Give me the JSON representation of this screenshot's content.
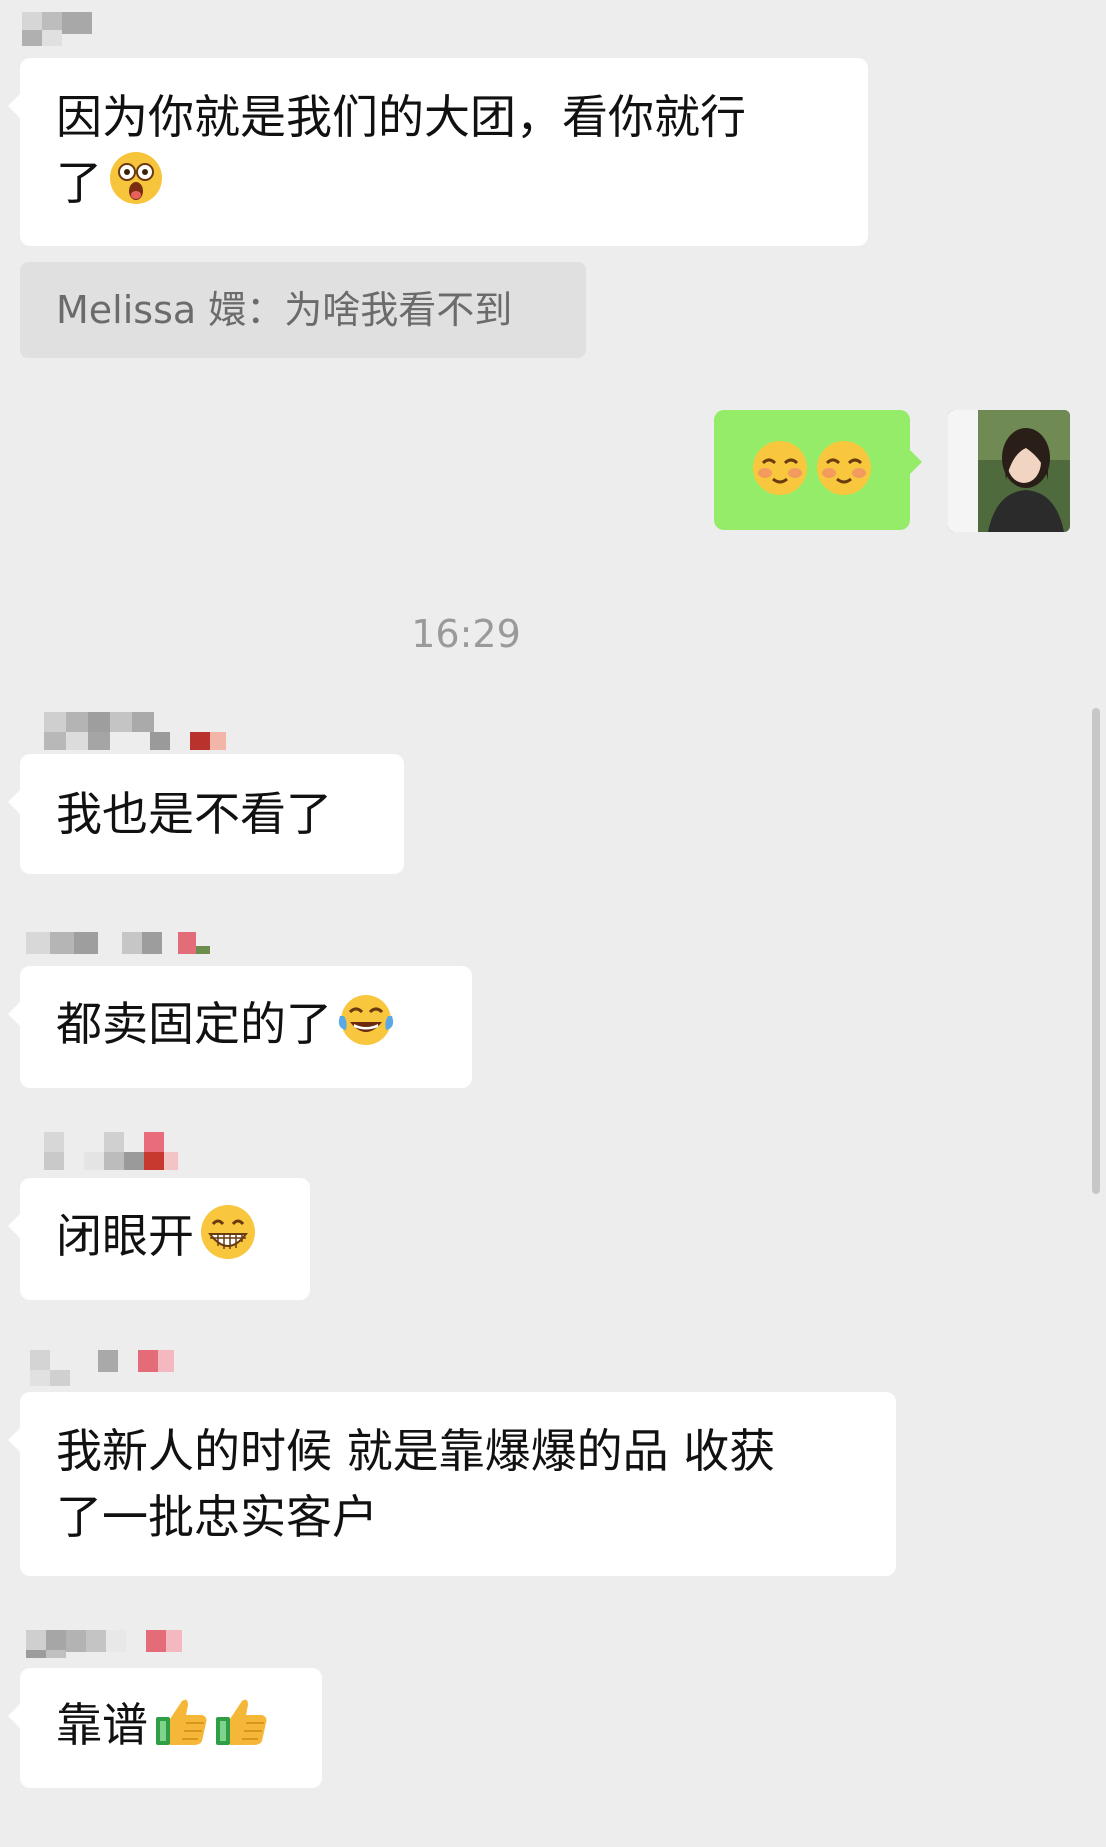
{
  "messages": [
    {
      "text_line1": "因为你就是我们的大团，看你就行",
      "text_line2": "了"
    },
    {
      "quote": "Melissa 嬛：为啥我看不到"
    },
    {
      "emoji": "shy-smile"
    },
    {
      "time": "16:29"
    },
    {
      "text": "我也是不看了"
    },
    {
      "text": "都卖固定的了"
    },
    {
      "text": "闭眼开"
    },
    {
      "text_line1": "我新人的时候 就是靠爆爆的品 收获",
      "text_line2": "了一批忠实客户"
    },
    {
      "text": "靠谱"
    }
  ],
  "colors": {
    "background": "#ededed",
    "bubble_incoming": "#ffffff",
    "bubble_outgoing": "#95ec69",
    "quote_bg": "#e0e0e0"
  }
}
